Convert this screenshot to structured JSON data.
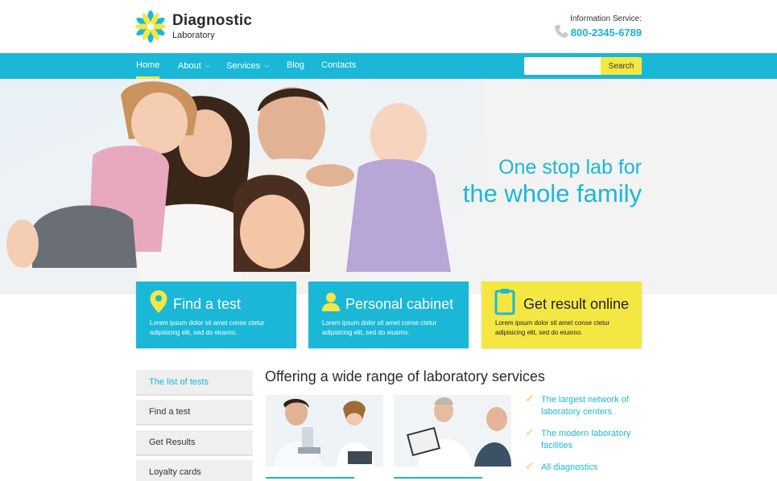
{
  "header": {
    "brand_name": "Diagnostic",
    "brand_sub": "Laboratory",
    "phone_label": "Information Service:",
    "phone_number": "800-2345-6789"
  },
  "nav": {
    "items": [
      {
        "label": "Home"
      },
      {
        "label": "About"
      },
      {
        "label": "Services"
      },
      {
        "label": "Blog"
      },
      {
        "label": "Contacts"
      }
    ],
    "search_placeholder": "",
    "search_button": "Search"
  },
  "hero": {
    "line1": "One stop lab for",
    "line2": "the whole family"
  },
  "features": [
    {
      "title": "Find a test",
      "text": "Lorem ipsum dolor sit amet conse ctetur adipisicing elit, sed do eiusmo.",
      "icon": "map-pin-icon"
    },
    {
      "title": "Personal cabinet",
      "text": "Lorem ipsum dolor sit amet conse ctetur adipisicing elit, sed do eiusmo.",
      "icon": "user-icon"
    },
    {
      "title": "Get result online",
      "text": "Lorem ipsum dolor sit amet conse ctetur adipisicing elit, sed do eiusmo.",
      "icon": "clipboard-icon"
    }
  ],
  "sidebar": {
    "items": [
      {
        "label": "The list of tests"
      },
      {
        "label": "Find a test"
      },
      {
        "label": "Get Results"
      },
      {
        "label": "Loyalty cards"
      }
    ]
  },
  "main": {
    "section_title": "Offering a wide range of laboratory services",
    "checklist": [
      {
        "label": "The largest network of laboratory centers"
      },
      {
        "label": "The modern laboratory facilities"
      },
      {
        "label": "All diagnostics"
      }
    ]
  },
  "colors": {
    "accent": "#1ab8d6",
    "highlight": "#f5e742"
  }
}
